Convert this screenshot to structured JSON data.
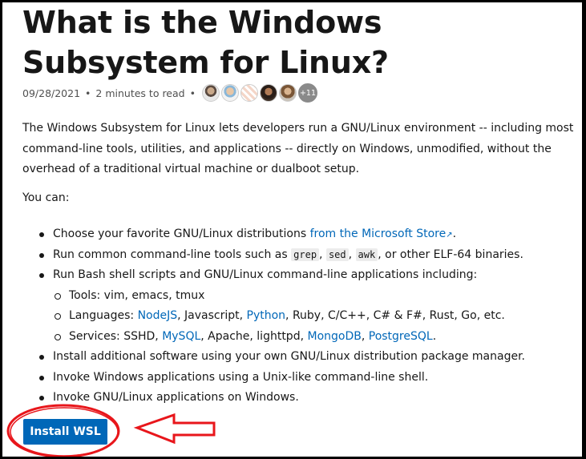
{
  "article": {
    "title": "What is the Windows Subsystem for Linux?",
    "date": "09/28/2021",
    "separator": "•",
    "read_time": "2 minutes to read",
    "contributors_more": "+11",
    "intro": "The Windows Subsystem for Linux lets developers run a GNU/Linux environment -- including most command-line tools, utilities, and applications -- directly on Windows, unmodified, without the overhead of a traditional virtual machine or dualboot setup.",
    "you_can": "You can:",
    "items": {
      "distro_prefix": "Choose your favorite GNU/Linux distributions ",
      "distro_link": "from the Microsoft Store",
      "distro_suffix": ".",
      "tools_prefix": "Run common command-line tools such as ",
      "code_grep": "grep",
      "comma1": ", ",
      "code_sed": "sed",
      "comma2": ", ",
      "code_awk": "awk",
      "tools_suffix": ", or other ELF-64 binaries.",
      "bash": "Run Bash shell scripts and GNU/Linux command-line applications including:",
      "sub_tools": "Tools: vim, emacs, tmux",
      "lang_prefix": "Languages: ",
      "lang_nodejs": "NodeJS",
      "lang_mid": ", Javascript, ",
      "lang_python": "Python",
      "lang_suffix": ", Ruby, C/C++, C# & F#, Rust, Go, etc.",
      "svc_prefix": "Services: SSHD, ",
      "svc_mysql": "MySQL",
      "svc_mid": ", Apache, lighttpd, ",
      "svc_mongodb": "MongoDB",
      "svc_comma": ", ",
      "svc_postgres": "PostgreSQL",
      "svc_suffix": ".",
      "install_sw": "Install additional software using your own GNU/Linux distribution package manager.",
      "invoke_win": "Invoke Windows applications using a Unix-like command-line shell.",
      "invoke_linux": "Invoke GNU/Linux applications on Windows."
    },
    "install_button": "Install WSL"
  },
  "icons": {
    "external_link": "external-link-icon"
  },
  "colors": {
    "link": "#0067b8",
    "button": "#0067b8",
    "annotation": "#e8161b",
    "text": "#171717"
  }
}
